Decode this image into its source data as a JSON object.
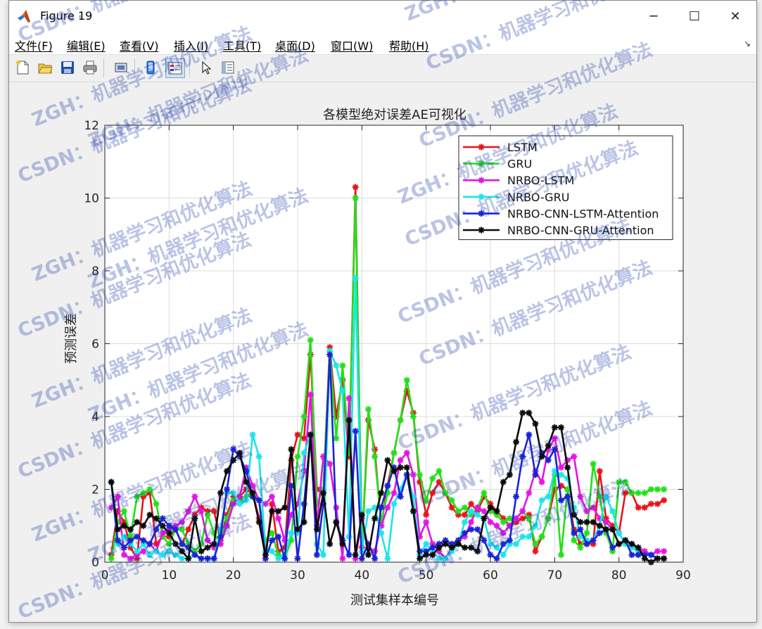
{
  "window": {
    "title": "Figure 19",
    "minimize_symbol": "─",
    "maximize_symbol": "☐",
    "close_symbol": "✕"
  },
  "menu": {
    "items": [
      "文件(F)",
      "编辑(E)",
      "查看(V)",
      "插入(I)",
      "工具(T)",
      "桌面(D)",
      "窗口(W)",
      "帮助(H)"
    ],
    "overflow_symbol": "↘"
  },
  "toolbar": {
    "icons": [
      "new-figure-icon",
      "open-file-icon",
      "save-icon",
      "print-icon",
      "print-preview-icon",
      "link-plot-icon",
      "insert-legend-icon",
      "pointer-icon",
      "property-editor-icon"
    ]
  },
  "watermark": {
    "line1": "ZGH：机器学习和优化算法",
    "line2": "CSDN：机器学习和优化算法"
  },
  "chart_data": {
    "type": "line",
    "title": "各模型绝对误差AE可视化",
    "xlabel": "测试集样本编号",
    "ylabel": "预测误差",
    "xlim": [
      0,
      90
    ],
    "ylim": [
      0,
      12
    ],
    "xticks": [
      0,
      10,
      20,
      30,
      40,
      50,
      60,
      70,
      80,
      90
    ],
    "yticks": [
      0,
      2,
      4,
      6,
      8,
      10,
      12
    ],
    "grid": true,
    "legend_position": "top-right",
    "marker": "asterisk",
    "series": [
      {
        "name": "LSTM",
        "color": "#e8141b",
        "values": [
          0.2,
          1.4,
          1.1,
          0.4,
          0.1,
          1.8,
          1.9,
          0.5,
          0.7,
          0.7,
          0.9,
          0.5,
          0.9,
          1.3,
          1.5,
          1.4,
          1.4,
          0.6,
          1.3,
          1.8,
          1.8,
          2.0,
          1.9,
          1.2,
          0.1,
          1.6,
          0.3,
          0.4,
          2.8,
          3.5,
          3.4,
          5.7,
          2.0,
          2.0,
          5.9,
          4.0,
          5.0,
          2.9,
          10.3,
          0.4,
          3.9,
          3.1,
          1.0,
          2.1,
          3.0,
          3.9,
          4.7,
          4.1,
          2.2,
          1.3,
          1.9,
          2.2,
          1.9,
          1.5,
          1.3,
          1.3,
          1.6,
          1.4,
          1.8,
          1.6,
          1.4,
          1.2,
          1.0,
          1.1,
          1.2,
          1.3,
          0.3,
          0.7,
          1.2,
          2.0,
          2.1,
          2.0,
          0.9,
          0.5,
          0.5,
          0.5,
          2.5,
          1.2,
          1.0,
          0.8,
          1.9,
          1.9,
          1.5,
          1.5,
          1.6,
          1.6,
          1.7
        ]
      },
      {
        "name": "GRU",
        "color": "#22e01a",
        "values": [
          0.1,
          1.1,
          1.4,
          0.7,
          1.8,
          1.9,
          2.0,
          1.6,
          0.7,
          0.5,
          0.9,
          0.9,
          0.5,
          0.3,
          0.5,
          1.3,
          0.8,
          0.5,
          1.2,
          1.7,
          1.7,
          1.8,
          1.9,
          1.7,
          0.6,
          0.8,
          0.2,
          0.1,
          0.6,
          2.9,
          4.0,
          6.1,
          1.6,
          2.0,
          5.8,
          3.4,
          5.4,
          3.0,
          10.0,
          0.3,
          4.2,
          2.9,
          1.1,
          1.9,
          3.0,
          3.9,
          5.0,
          4.0,
          2.4,
          1.7,
          2.3,
          2.5,
          1.9,
          1.7,
          1.4,
          1.5,
          1.3,
          1.5,
          1.9,
          1.4,
          1.3,
          1.1,
          1.2,
          1.2,
          1.4,
          1.2,
          0.5,
          0.7,
          1.2,
          2.4,
          0.2,
          2.0,
          0.6,
          0.4,
          0.8,
          2.7,
          1.8,
          0.8,
          0.3,
          2.2,
          2.2,
          1.9,
          1.9,
          1.9,
          2.0,
          2.0,
          2.0
        ]
      },
      {
        "name": "NRBO-LSTM",
        "color": "#e314e3",
        "values": [
          1.5,
          1.8,
          0.2,
          0.1,
          0.2,
          0.3,
          0.5,
          0.3,
          0.8,
          0.9,
          1.0,
          1.1,
          1.4,
          1.8,
          1.4,
          0.6,
          0.4,
          0.5,
          1.0,
          1.6,
          1.8,
          2.6,
          2.1,
          1.7,
          1.6,
          1.8,
          1.2,
          0.6,
          1.3,
          1.6,
          2.5,
          4.6,
          1.0,
          2.9,
          2.7,
          1.5,
          0.1,
          4.5,
          0.1,
          1.2,
          0.4,
          0.3,
          1.0,
          1.5,
          1.9,
          2.8,
          3.0,
          2.4,
          0.7,
          1.1,
          0.5,
          0.3,
          0.1,
          0.4,
          0.6,
          0.7,
          1.1,
          1.5,
          1.4,
          1.1,
          1.0,
          0.8,
          1.0,
          1.2,
          1.4,
          1.9,
          2.5,
          2.2,
          3.1,
          3.4,
          2.6,
          2.8,
          2.9,
          1.8,
          1.4,
          1.5,
          1.2,
          1.1,
          0.9,
          0.5,
          0.6,
          0.5,
          0.4,
          0.3,
          0.2,
          0.3,
          0.3
        ]
      },
      {
        "name": "NRBO-GRU",
        "color": "#19e5ec",
        "values": [
          2.2,
          0.5,
          0.7,
          0.5,
          0.3,
          0.5,
          0.2,
          0.3,
          0.2,
          0.3,
          0.2,
          0.1,
          0.1,
          0.2,
          0.1,
          0.1,
          0.1,
          0.9,
          1.9,
          1.9,
          1.6,
          1.7,
          3.5,
          2.9,
          0.3,
          0.3,
          0.1,
          0.2,
          0.8,
          0.8,
          3.0,
          3.5,
          0.5,
          0.2,
          5.8,
          5.4,
          4.7,
          0.7,
          7.8,
          0.3,
          1.4,
          1.5,
          0.8,
          0.1,
          1.6,
          2.0,
          2.4,
          1.8,
          0.2,
          0.5,
          0.3,
          0.1,
          0.1,
          0.3,
          0.5,
          1.1,
          1.4,
          1.3,
          1.2,
          0.5,
          0.4,
          0.2,
          0.5,
          0.5,
          0.7,
          0.7,
          1.0,
          1.7,
          1.8,
          2.5,
          2.4,
          2.3,
          1.5,
          0.7,
          0.6,
          0.6,
          1.0,
          1.8,
          1.4,
          0.8,
          0.5,
          0.4,
          0.3,
          0.2,
          0.2,
          0.1,
          0.1
        ]
      },
      {
        "name": "NRBO-CNN-LSTM-Attention",
        "color": "#1b23d6",
        "values": [
          2.2,
          0.6,
          0.4,
          0.6,
          0.7,
          0.6,
          0.5,
          0.9,
          1.2,
          1.0,
          0.9,
          0.5,
          0.4,
          0.2,
          0.1,
          0.1,
          0.1,
          0.7,
          2.0,
          3.1,
          2.9,
          2.5,
          1.8,
          1.7,
          0.1,
          0.6,
          0.7,
          0.1,
          2.1,
          0.1,
          1.6,
          3.5,
          0.2,
          1.6,
          5.7,
          1.1,
          0.6,
          0.2,
          3.6,
          0.1,
          0.5,
          0.1,
          1.5,
          2.1,
          2.6,
          1.8,
          2.4,
          1.4,
          0.3,
          0.3,
          0.4,
          0.5,
          0.6,
          0.5,
          0.6,
          0.8,
          0.9,
          0.9,
          0.6,
          0.2,
          0.1,
          0.5,
          0.6,
          1.8,
          2.9,
          3.5,
          2.4,
          3.0,
          2.8,
          3.1,
          1.7,
          1.8,
          0.8,
          0.9,
          0.5,
          0.6,
          0.8,
          0.9,
          0.4,
          0.5,
          0.6,
          0.2,
          0.2,
          0.2,
          0.2,
          0.1,
          0.1
        ]
      },
      {
        "name": "NRBO-CNN-GRU-Attention",
        "color": "#0b0b0b",
        "values": [
          2.2,
          0.9,
          1.0,
          0.9,
          1.1,
          1.0,
          1.3,
          1.2,
          1.0,
          0.8,
          0.5,
          0.3,
          0.1,
          1.2,
          0.3,
          0.4,
          0.5,
          1.9,
          2.5,
          2.8,
          3.0,
          2.2,
          1.9,
          1.1,
          0.2,
          1.4,
          1.4,
          1.5,
          3.1,
          0.9,
          1.1,
          3.5,
          0.9,
          1.9,
          0.5,
          1.1,
          0.5,
          3.9,
          0.2,
          1.3,
          0.2,
          1.2,
          1.9,
          2.8,
          2.5,
          2.6,
          2.6,
          1.4,
          0.1,
          0.2,
          0.2,
          0.4,
          0.5,
          0.4,
          0.5,
          0.4,
          0.4,
          0.3,
          1.2,
          1.5,
          1.4,
          2.2,
          2.4,
          3.3,
          4.1,
          4.1,
          3.8,
          2.9,
          3.2,
          3.7,
          3.7,
          2.6,
          1.3,
          1.1,
          1.1,
          1.1,
          1.0,
          0.9,
          0.9,
          0.5,
          0.6,
          0.5,
          0.4,
          0.1,
          0.0,
          0.1,
          0.1
        ]
      }
    ]
  }
}
